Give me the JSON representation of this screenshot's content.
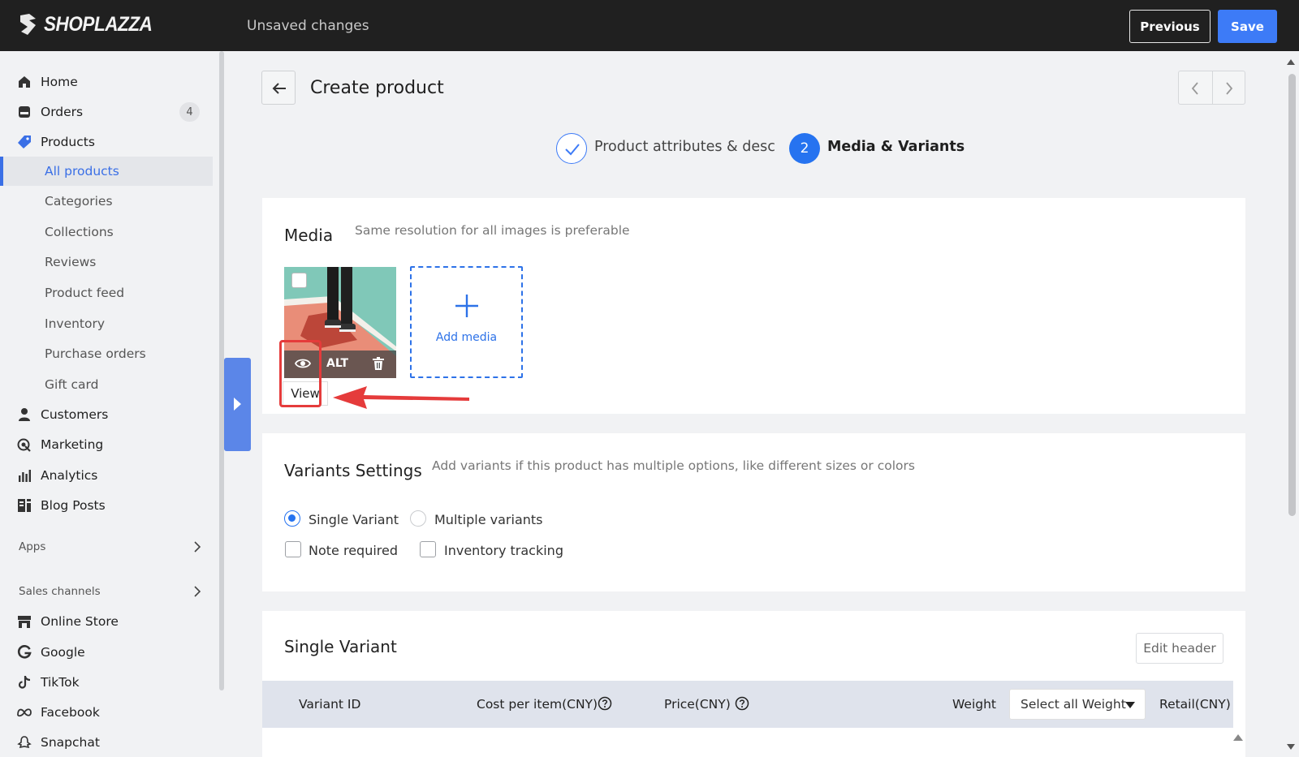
{
  "topbar": {
    "brand": "SHOPLAZZA",
    "status": "Unsaved changes",
    "previous_label": "Previous",
    "save_label": "Save"
  },
  "sidebar": {
    "items": [
      {
        "label": "Home",
        "icon": "home-icon"
      },
      {
        "label": "Orders",
        "icon": "orders-icon",
        "badge": "4"
      },
      {
        "label": "Products",
        "icon": "tag-icon"
      }
    ],
    "product_subitems": [
      {
        "label": "All products",
        "active": true
      },
      {
        "label": "Categories"
      },
      {
        "label": "Collections"
      },
      {
        "label": "Reviews"
      },
      {
        "label": "Product feed"
      },
      {
        "label": "Inventory"
      },
      {
        "label": "Purchase orders"
      },
      {
        "label": "Gift card"
      }
    ],
    "items2": [
      {
        "label": "Customers",
        "icon": "person-icon"
      },
      {
        "label": "Marketing",
        "icon": "marketing-icon"
      },
      {
        "label": "Analytics",
        "icon": "bar-chart-icon"
      },
      {
        "label": "Blog Posts",
        "icon": "blog-icon"
      }
    ],
    "apps_label": "Apps",
    "sales_channels_label": "Sales channels",
    "channels": [
      {
        "label": "Online Store",
        "icon": "store-icon"
      },
      {
        "label": "Google",
        "icon": "google-icon"
      },
      {
        "label": "TikTok",
        "icon": "tiktok-icon"
      },
      {
        "label": "Facebook",
        "icon": "meta-icon"
      },
      {
        "label": "Snapchat",
        "icon": "snapchat-icon"
      }
    ]
  },
  "page": {
    "title": "Create product",
    "steps": [
      {
        "label": "Product attributes & descri",
        "state": "done"
      },
      {
        "number": "2",
        "label": "Media & Variants",
        "state": "current"
      }
    ]
  },
  "media": {
    "title": "Media",
    "hint": "Same resolution for all images is preferable",
    "alt_label": "ALT",
    "view_tooltip": "View",
    "add_media_label": "Add media"
  },
  "variants_settings": {
    "title": "Variants Settings",
    "hint": "Add variants if this product has multiple options, like different sizes or colors",
    "single_variant_label": "Single Variant",
    "multiple_variants_label": "Multiple variants",
    "note_required_label": "Note required",
    "inventory_tracking_label": "Inventory tracking",
    "selected": "Single Variant"
  },
  "single_variant": {
    "title": "Single Variant",
    "edit_header_label": "Edit header",
    "columns": {
      "variant_id": "Variant ID",
      "cost": "Cost per item(CNY)",
      "price": "Price(CNY)",
      "weight": "Weight",
      "weight_select": "Select all Weight",
      "retail": "Retail(CNY)"
    }
  },
  "colors": {
    "accent": "#2673f0",
    "topbar": "#202020",
    "highlight": "#e53b3b"
  }
}
